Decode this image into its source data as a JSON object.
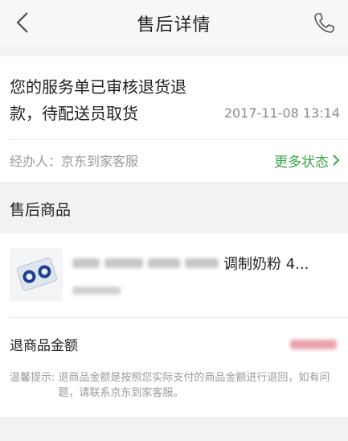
{
  "nav": {
    "title": "售后详情",
    "back_icon": "back-chevron-icon",
    "phone_icon": "phone-icon"
  },
  "status": {
    "message": "您的服务单已审核退货退款，待配送员取货",
    "time": "2017-11-08 13:14",
    "handler": "经办人：京东到家客服",
    "more_label": "更多状态",
    "more_color": "#3aa64a"
  },
  "goods_section": {
    "title": "售后商品",
    "item": {
      "name_tail": "调制奶粉 4...",
      "thumb_icon": "milk-powder-product-image"
    }
  },
  "refund": {
    "amount_label": "退商品金额"
  },
  "tip": {
    "label": "温馨提示:",
    "text": "退商品金额是按照您实际支付的商品金额进行退回，如有问题，请联系京东到家客服。"
  }
}
